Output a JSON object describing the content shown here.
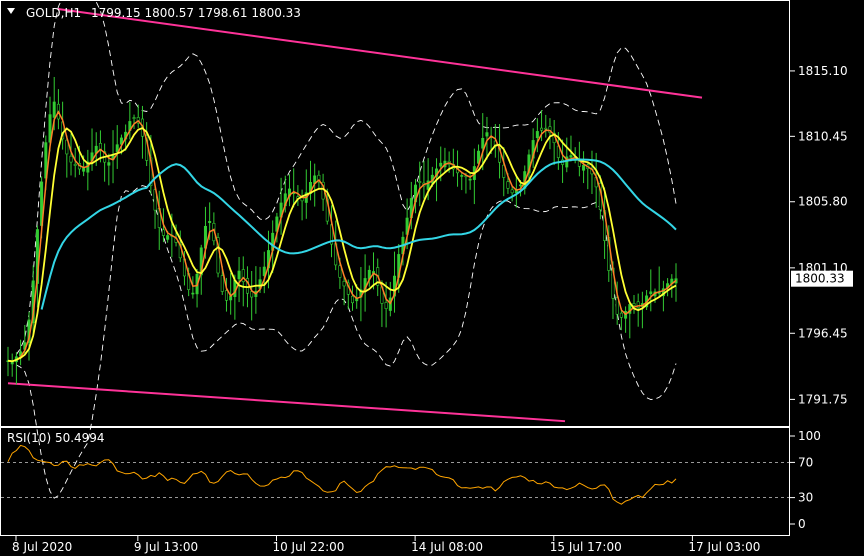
{
  "header": {
    "symbol": "GOLD,H1",
    "ohlc": "1799.15 1800.57 1798.61 1800.33"
  },
  "colors": {
    "background": "#000000",
    "frame": "#ffffff",
    "candles": "#33cc33",
    "ma_fast": "#ff7f27",
    "ma_mid": "#ffff33",
    "ma_slow": "#33d6e6",
    "bands": "#ffffff",
    "trendlines": "#ff3399",
    "rsi": "#ffa500",
    "rsi_levels": "#cccccc",
    "price_box": "#ffffff"
  },
  "chart_data": [
    {
      "type": "candlestick",
      "title": "GOLD,H1",
      "current_price": 1800.33,
      "current_price_label": "1800.33",
      "ylim": [
        1790.0,
        1820.0
      ],
      "y_ticks": [
        1791.75,
        1796.45,
        1801.1,
        1805.8,
        1810.45,
        1815.1
      ],
      "y_tick_labels": [
        "1791.75",
        "1796.45",
        "1801.10",
        "1805.80",
        "1810.45",
        "1815.10"
      ],
      "x_tick_labels": [
        "8 Jul 2020",
        "9 Jul 13:00",
        "10 Jul 22:00",
        "14 Jul 08:00",
        "15 Jul 17:00",
        "17 Jul 03:00"
      ],
      "x_tick_index": [
        0,
        29,
        62,
        95,
        128,
        161
      ],
      "bars_total": 160,
      "close": [
        1794.5,
        1794.4,
        1795.0,
        1795.3,
        1797.1,
        1800.5,
        1805.1,
        1809.0,
        1811.8,
        1812.9,
        1811.4,
        1809.6,
        1808.7,
        1808.4,
        1808.1,
        1808.2,
        1809.0,
        1809.8,
        1809.5,
        1808.4,
        1808.7,
        1809.7,
        1810.3,
        1810.8,
        1811.8,
        1811.7,
        1810.8,
        1808.7,
        1806.5,
        1804.4,
        1803.4,
        1803.4,
        1803.4,
        1802.7,
        1801.0,
        1799.6,
        1799.3,
        1801.0,
        1803.5,
        1804.8,
        1803.2,
        1800.4,
        1799.0,
        1798.6,
        1800.1,
        1800.9,
        1799.9,
        1798.9,
        1799.2,
        1800.2,
        1801.3,
        1802.8,
        1804.3,
        1805.6,
        1806.4,
        1806.8,
        1806.2,
        1805.7,
        1806.4,
        1807.3,
        1807.8,
        1806.6,
        1804.7,
        1802.7,
        1800.9,
        1800.1,
        1799.4,
        1798.6,
        1799.0,
        1799.8,
        1800.9,
        1801.0,
        1799.8,
        1798.2,
        1798.2,
        1800.1,
        1802.0,
        1803.5,
        1805.2,
        1806.9,
        1807.2,
        1806.9,
        1807.4,
        1807.9,
        1808.5,
        1808.7,
        1808.4,
        1808.0,
        1807.7,
        1807.6,
        1807.4,
        1808.6,
        1810.0,
        1810.8,
        1810.4,
        1809.6,
        1808.1,
        1806.9,
        1806.4,
        1806.7,
        1807.1,
        1808.6,
        1810.0,
        1810.8,
        1810.9,
        1811.0,
        1810.4,
        1809.0,
        1808.4,
        1809.2,
        1809.0,
        1808.3,
        1808.4,
        1808.1,
        1807.6,
        1806.0,
        1803.3,
        1800.7,
        1798.3,
        1797.4,
        1797.9,
        1798.5,
        1798.4,
        1798.2,
        1799.0,
        1799.4,
        1799.4,
        1799.4,
        1799.8,
        1800.3,
        1800.33
      ],
      "volume_note": "",
      "overlays": [
        "moving averages",
        "bollinger bands",
        "trendlines"
      ],
      "trendline_upper": [
        [
          0,
          1819.5
        ],
        [
          160,
          1813.2
        ]
      ],
      "trendline_lower": [
        [
          0,
          1792.9
        ],
        [
          135,
          1790.2
        ]
      ]
    },
    {
      "type": "line",
      "title": "RSI(10) 50.4994",
      "ylim": [
        0,
        100
      ],
      "y_ticks": [
        0,
        30,
        70,
        100
      ],
      "y_tick_labels": [
        "0",
        "30",
        "70",
        "100"
      ],
      "levels": [
        30,
        70
      ],
      "values": [
        70,
        80,
        86,
        89,
        85,
        78,
        74,
        72,
        70,
        68,
        64,
        69,
        70,
        66,
        64,
        68,
        67,
        68,
        66,
        71,
        74,
        70,
        64,
        60,
        58,
        56,
        57,
        54,
        51,
        55,
        53,
        57,
        54,
        49,
        52,
        47,
        44,
        50,
        57,
        60,
        58,
        51,
        46,
        48,
        55,
        62,
        61,
        56,
        58,
        59,
        52,
        46,
        42,
        45,
        48,
        52,
        55,
        54,
        57,
        62,
        60,
        55,
        49,
        44,
        40,
        37,
        35,
        38,
        44,
        49,
        44,
        38,
        37,
        41,
        45,
        50,
        57,
        62,
        65,
        66,
        64,
        63,
        62,
        63,
        62,
        64,
        63,
        60,
        58,
        55,
        51,
        50,
        45,
        43,
        40,
        42,
        40,
        41,
        44,
        41,
        39,
        44,
        48,
        51,
        53,
        55,
        52,
        50,
        48,
        47,
        47,
        46,
        44,
        42,
        40,
        41,
        42,
        45,
        44,
        41,
        38,
        43,
        47,
        44,
        30,
        25,
        23,
        27,
        32,
        31,
        30,
        36,
        40,
        45,
        46,
        47,
        48,
        50
      ]
    }
  ]
}
